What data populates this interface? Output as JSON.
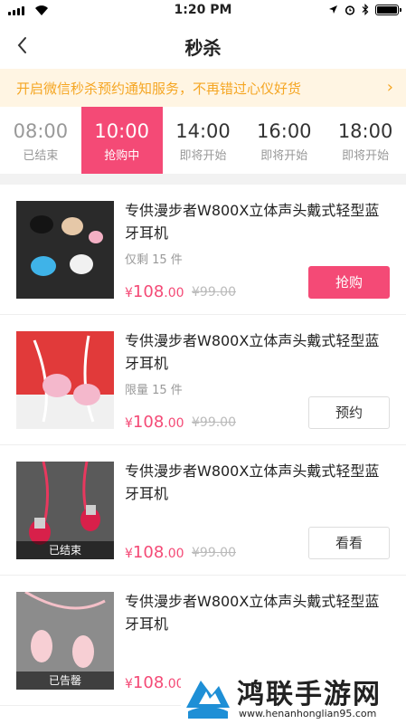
{
  "status_bar": {
    "time": "1:20 PM"
  },
  "nav": {
    "title": "秒杀",
    "back_icon": "chevron-left-icon"
  },
  "notice": {
    "text": "开启微信秒杀预约通知服务，不再错过心仪好货",
    "arrow": "›"
  },
  "tabs": [
    {
      "time": "08:00",
      "status": "已结束",
      "state": "ended"
    },
    {
      "time": "10:00",
      "status": "抢购中",
      "state": "active"
    },
    {
      "time": "14:00",
      "status": "即将开始",
      "state": "upcoming"
    },
    {
      "time": "16:00",
      "status": "即将开始",
      "state": "upcoming"
    },
    {
      "time": "18:00",
      "status": "即将开始",
      "state": "upcoming"
    }
  ],
  "products": [
    {
      "name": "专供漫步者W800X立体声头戴式轻型蓝牙耳机",
      "stock": "仅剩 15 件",
      "price_symbol": "¥",
      "price_int": "108",
      "price_dec": ".00",
      "original_price": "¥99.00",
      "button": "抢购",
      "overlay": ""
    },
    {
      "name": "专供漫步者W800X立体声头戴式轻型蓝牙耳机",
      "stock": "限量 15 件",
      "price_symbol": "¥",
      "price_int": "108",
      "price_dec": ".00",
      "original_price": "¥99.00",
      "button": "预约",
      "overlay": ""
    },
    {
      "name": "专供漫步者W800X立体声头戴式轻型蓝牙耳机",
      "stock": "",
      "price_symbol": "¥",
      "price_int": "108",
      "price_dec": ".00",
      "original_price": "¥99.00",
      "button": "看看",
      "overlay": "已结束"
    },
    {
      "name": "专供漫步者W800X立体声头戴式轻型蓝牙耳机",
      "stock": "",
      "price_symbol": "¥",
      "price_int": "108",
      "price_dec": ".00",
      "original_price": "",
      "button": "",
      "overlay": "已告罄"
    }
  ],
  "watermark": {
    "title": "鸿联手游网",
    "url": "www.henanhonglian95.com"
  },
  "colors": {
    "accent": "#f44a76",
    "notice_text": "#f5a623",
    "notice_bg": "#fff5e3"
  }
}
